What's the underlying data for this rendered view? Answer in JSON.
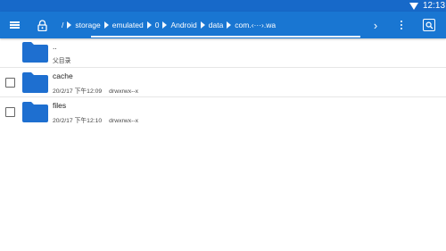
{
  "status": {
    "time": "12:13"
  },
  "toolbar": {
    "path_segments": [
      "/",
      "storage",
      "emulated",
      "0",
      "Android",
      "data",
      "com.‹···›.wa"
    ],
    "accent": "#1976d2"
  },
  "files": [
    {
      "name": "..",
      "subtitle": "父目录"
    },
    {
      "name": "cache",
      "date": "20/2/17 下午12:09",
      "permissions": "drwxrwx--x"
    },
    {
      "name": "files",
      "date": "20/2/17 下午12:10",
      "permissions": "drwxrwx--x"
    }
  ],
  "colors": {
    "folder": "#1e6fd0",
    "statusbar": "#1769c9"
  }
}
